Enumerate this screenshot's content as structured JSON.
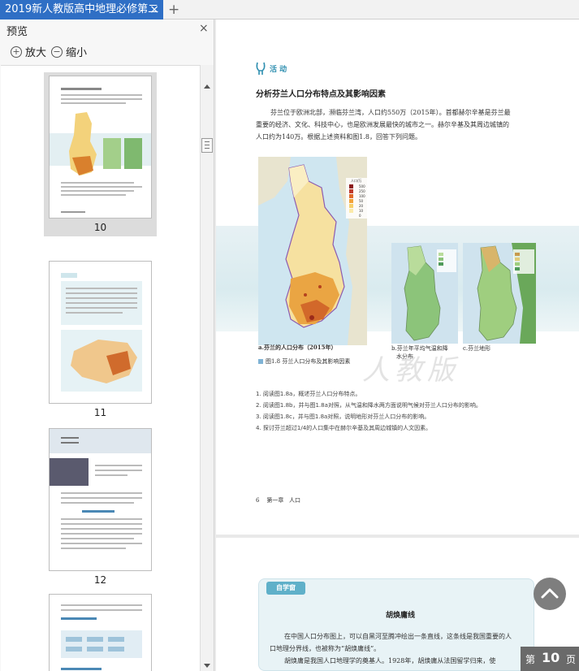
{
  "tab": {
    "title": "2019新人教版高中地理必修第二",
    "close": "×",
    "add": "+"
  },
  "panel": {
    "title": "预览",
    "close": "×",
    "zoom_in": "放大",
    "zoom_out": "缩小"
  },
  "thumbnails": [
    {
      "page": "10"
    },
    {
      "page": "11"
    },
    {
      "page": "12"
    }
  ],
  "page": {
    "activity_label": "活 动",
    "heading": "分析芬兰人口分布特点及其影响因素",
    "intro": [
      "芬兰位于欧洲北部，濒临芬兰湾，人口约550万（2015年）。首都赫尔辛基是芬兰最",
      "重要的经济、文化、科技中心，也是欧洲发展最快的城市之一。赫尔辛基及其周边城镇的",
      "人口约为140万。根据上述资料和图1.8，回答下列问题。"
    ],
    "map_a_caption": "a.芬兰的人口分布（2015年）",
    "map_b_caption": [
      "b.芬兰年平均气温和降",
      "水分布"
    ],
    "map_c_caption": "c.芬兰地形",
    "figure_caption": "图1.8  芬兰人口分布及其影响因素",
    "legend_title": "人口/万",
    "legend_values": [
      "500",
      "250",
      "100",
      "50",
      "20",
      "10",
      "0"
    ],
    "questions": [
      "1. 阅读图1.8a，概述芬兰人口分布特点。",
      "2. 阅读图1.8b，并与图1.8a对照，从气温和降水两方面说明气候对芬兰人口分布的影响。",
      "3. 阅读图1.8c，并与图1.8a对照，说明地形对芬兰人口分布的影响。",
      "4. 探讨芬兰超过1/4的人口集中在赫尔辛基及其周边城镇的人文因素。"
    ],
    "footer": "6    第一章   人口",
    "watermark": "人教版"
  },
  "page2": {
    "section_label": "自学窗",
    "title": "胡焕庸线",
    "lines": [
      "在中国人口分布图上，可以自黑河至腾冲绘出一条直线，这条线是我国重要的人",
      "口地理分界线，也被称为“胡焕庸线”。",
      "胡焕庸是我国人口地理学的奠基人。1928年，胡焕庸从法国留学归来，使"
    ]
  },
  "nav": {
    "page_prefix": "第",
    "page_number": "10",
    "page_suffix": "页"
  },
  "colors": {
    "tab_active": "#2f6fc5",
    "accent": "#2f8fb0"
  }
}
